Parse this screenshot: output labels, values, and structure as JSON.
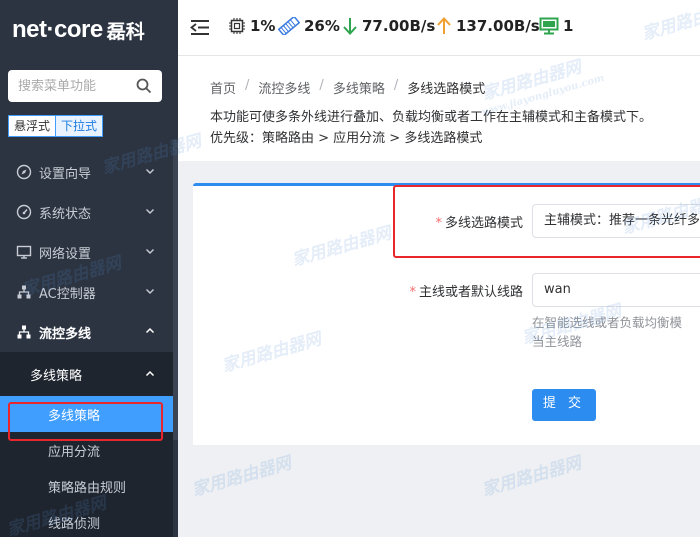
{
  "brand": {
    "logo_text": "net·core",
    "logo_cn": "磊科"
  },
  "sidebar": {
    "search_placeholder": "搜索菜单功能",
    "modes": [
      "悬浮式",
      "下拉式"
    ],
    "items": [
      {
        "label": "设置向导",
        "icon": "compass-icon"
      },
      {
        "label": "系统状态",
        "icon": "gauge-icon"
      },
      {
        "label": "网络设置",
        "icon": "monitor-icon"
      },
      {
        "label": "AC控制器",
        "icon": "network-icon"
      },
      {
        "label": "流控多线",
        "icon": "hierarchy-icon"
      }
    ],
    "submenu_header": "多线策略",
    "subitems": [
      "多线策略",
      "应用分流",
      "策略路由规则",
      "线路侦测"
    ]
  },
  "topbar": {
    "cpu": "1%",
    "memory": "26%",
    "download": "77.00B/s",
    "upload": "137.00B/s",
    "devices": "1"
  },
  "breadcrumb": [
    "首页",
    "流控多线",
    "多线策略",
    "多线选路模式"
  ],
  "description": {
    "line1": "本功能可使多条外线进行叠加、负载均衡或者工作在主辅模式和主备模式下。",
    "line2": "优先级：策略路由 > 应用分流 > 多线选路模式"
  },
  "form": {
    "mode_label": "多线选路模式",
    "mode_value": "主辅模式：推荐一条光纤多",
    "line_label": "主线或者默认线路",
    "line_value": "wan",
    "hint_line1": "在智能选线或者负载均衡模",
    "hint_line2": "当主线路",
    "submit": "提 交"
  },
  "watermark": "家用路由器网",
  "watermark_sub": "www.jiayongluyou.com",
  "colors": {
    "accent": "#409eff",
    "sidebar_bg": "#2c3441",
    "highlight": "#e8262b",
    "button": "#2d8cf0"
  }
}
